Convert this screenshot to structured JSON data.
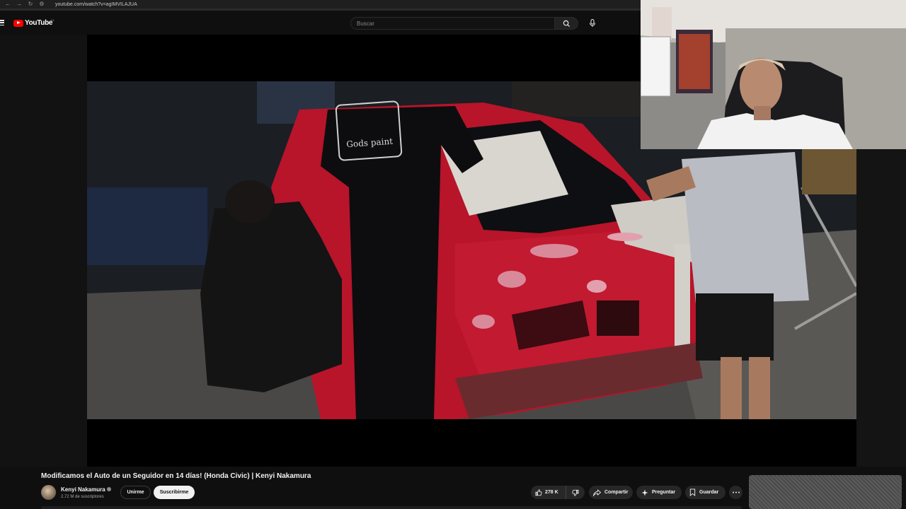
{
  "browser": {
    "url": "youtube.com/watch?v=agIMVILAJUA"
  },
  "header": {
    "logo_text": "YouTube",
    "country_code": "CL",
    "search_placeholder": "Buscar"
  },
  "video": {
    "shirt_print": "Gods paint",
    "title": "Modificamos el Auto de un Seguidor en 14 días! (Honda Civic) | Kenyi Nakamura"
  },
  "channel": {
    "name": "Kenyi Nakamura",
    "subscribers": "2,72 M de suscriptores",
    "join_label": "Unirme",
    "subscribe_label": "Suscribirme"
  },
  "actions": {
    "likes": "278 K",
    "share_label": "Compartir",
    "ask_label": "Preguntar",
    "save_label": "Guardar"
  },
  "colors": {
    "background": "#0f0f0f",
    "brand_red": "#ff0000",
    "pill": "#272727",
    "car_red": "#b8142a"
  },
  "icons": [
    "menu-icon",
    "youtube-logo-icon",
    "search-icon",
    "mic-icon",
    "verified-icon",
    "like-icon",
    "dislike-icon",
    "share-icon",
    "sparkle-icon",
    "save-icon",
    "more-icon"
  ]
}
